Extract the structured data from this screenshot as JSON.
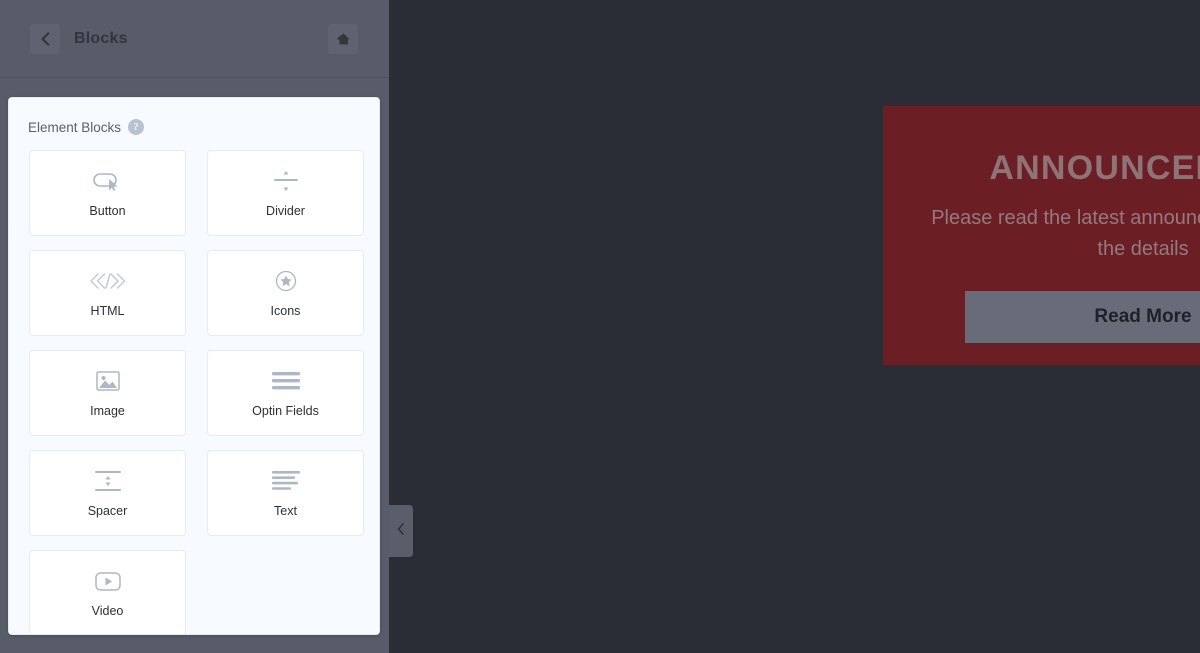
{
  "sidebar": {
    "header": {
      "title": "Blocks",
      "back_icon": "chevron-left-icon",
      "home_icon": "home-icon"
    },
    "panel": {
      "heading": "Element Blocks",
      "help_icon_label": "?",
      "blocks": [
        {
          "label": "Button",
          "icon": "button-cursor-icon"
        },
        {
          "label": "Divider",
          "icon": "divider-icon"
        },
        {
          "label": "HTML",
          "icon": "code-brackets-icon"
        },
        {
          "label": "Icons",
          "icon": "star-circle-icon"
        },
        {
          "label": "Image",
          "icon": "image-picture-icon"
        },
        {
          "label": "Optin Fields",
          "icon": "form-lines-icon"
        },
        {
          "label": "Spacer",
          "icon": "spacer-arrows-icon"
        },
        {
          "label": "Text",
          "icon": "text-lines-icon"
        },
        {
          "label": "Video",
          "icon": "video-play-icon"
        }
      ]
    },
    "collapse_handle_icon": "chevron-left-icon"
  },
  "canvas": {
    "announcement": {
      "title": "ANNOUNCEMENT",
      "body": "Please read the latest announcement to receive the details",
      "button_label": "Read More"
    }
  },
  "colors": {
    "sidebar": "#585c68",
    "panel_bg": "#f7faff",
    "tile_bg": "#ffffff",
    "canvas_bg": "#2b2d36",
    "announcement_bg": "#6b1f25",
    "announcement_button": "#686c79",
    "icon_gray": "#aeb7c6"
  }
}
